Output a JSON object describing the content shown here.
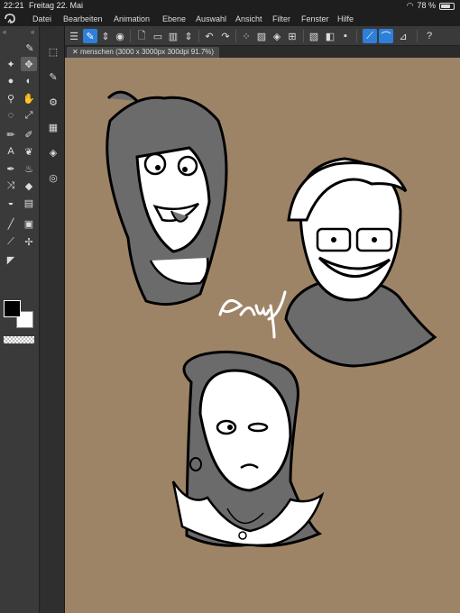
{
  "status_bar": {
    "time": "22:21",
    "date": "Freitag 22. Mai",
    "battery": "78 %",
    "battery_level": 0.78
  },
  "menu": [
    "Datei",
    "Bearbeiten",
    "Animation",
    "Ebene",
    "Auswahl",
    "Ansicht",
    "Filter",
    "Fenster",
    "Hilfe"
  ],
  "tab": {
    "label": "menschen (3000 x 3000px 300dpi 91.7%)"
  },
  "canvas": {
    "background_color": "#9e8467",
    "signature": "Pauy"
  },
  "colors": {
    "main": "#000000",
    "sub": "#ffffff"
  }
}
